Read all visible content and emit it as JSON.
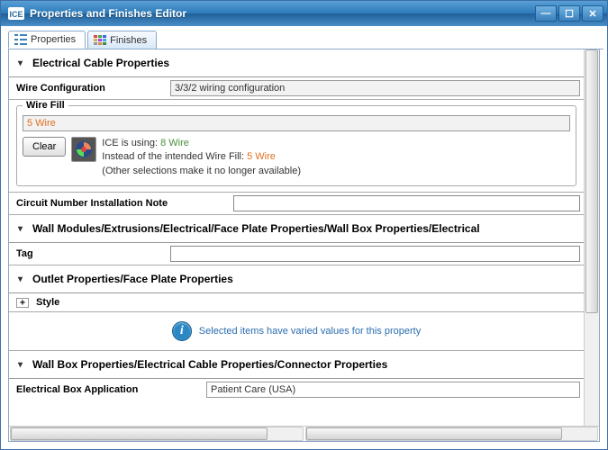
{
  "window": {
    "title": "Properties and Finishes Editor"
  },
  "tabs": {
    "properties": "Properties",
    "finishes": "Finishes"
  },
  "section1": {
    "title": "Electrical Cable Properties"
  },
  "wireConfig": {
    "label": "Wire Configuration",
    "value": "3/3/2 wiring configuration"
  },
  "wireFill": {
    "legend": "Wire Fill",
    "selected": "5 Wire",
    "clear": "Clear",
    "usingPrefix": "ICE is using:",
    "usingValue": "8 Wire",
    "insteadPrefix": "Instead of the intended Wire Fill:",
    "insteadValue": "5 Wire",
    "note": "(Other selections make it no longer available)"
  },
  "circuitNote": {
    "label": "Circuit Number Installation Note",
    "value": ""
  },
  "section2": {
    "title": "Wall Modules/Extrusions/Electrical/Face Plate Properties/Wall Box Properties/Electrical"
  },
  "tagRow": {
    "label": "Tag",
    "value": ""
  },
  "section3": {
    "title": "Outlet Properties/Face Plate Properties"
  },
  "styleRow": {
    "label": "Style"
  },
  "variedNote": "Selected items have varied values for this property",
  "section4": {
    "title": "Wall Box Properties/Electrical Cable Properties/Connector Properties"
  },
  "boxApp": {
    "label": "Electrical Box Application",
    "value": "Patient Care (USA)"
  }
}
